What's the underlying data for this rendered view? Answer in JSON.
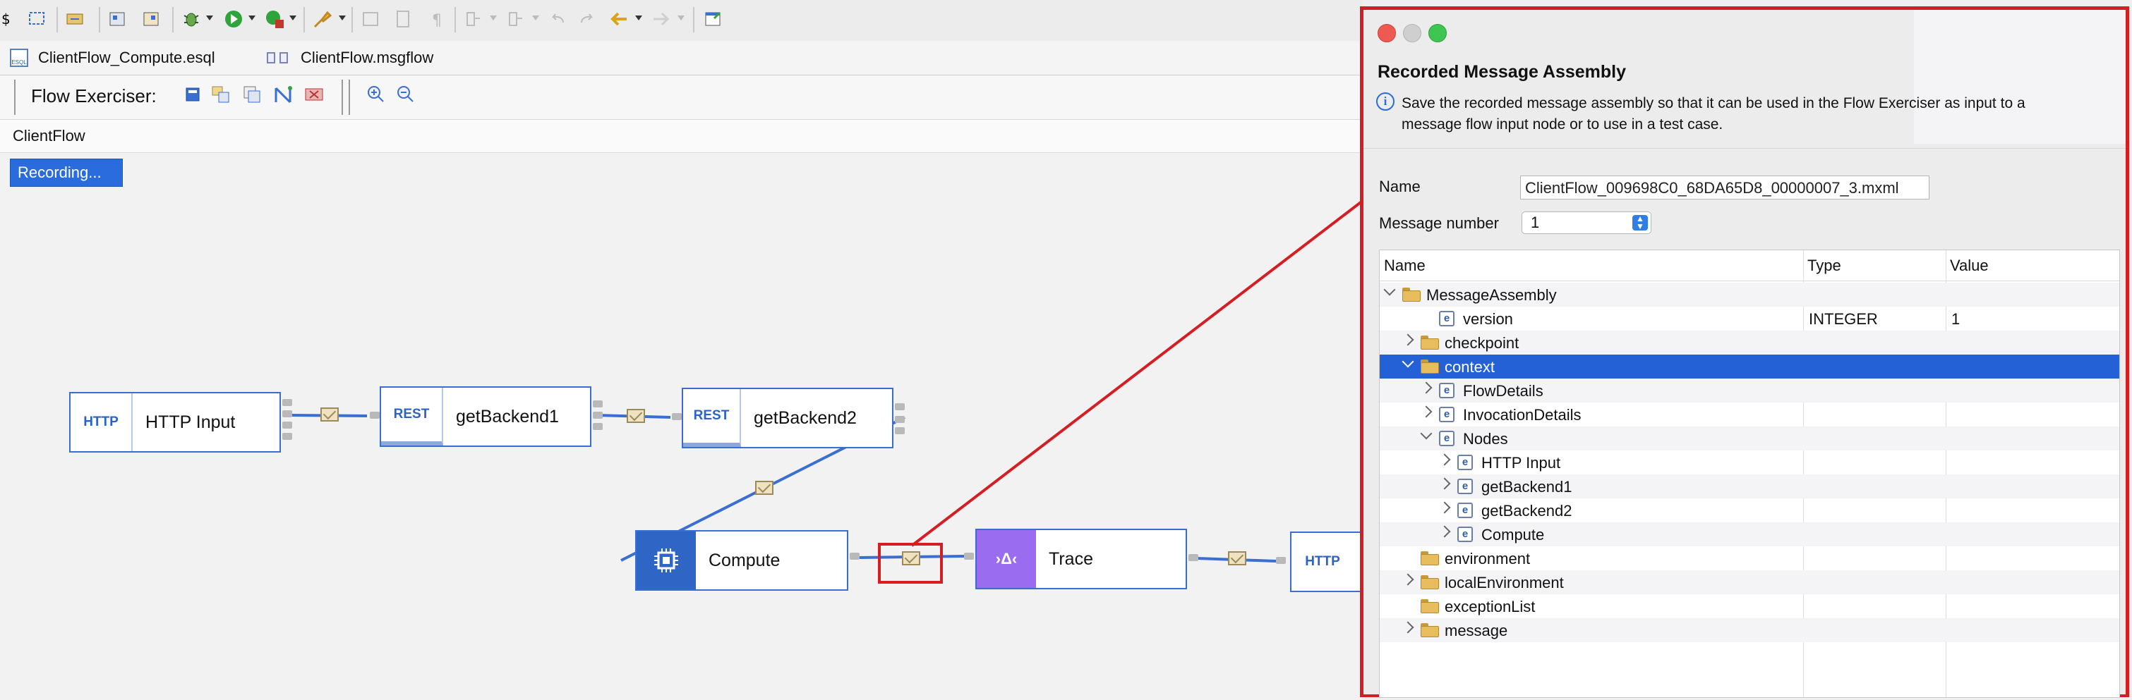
{
  "toolbar": {
    "icons": [
      "new-wizard-icon",
      "open-icon",
      "project-icon",
      "deploy-icon",
      "package-icon",
      "debug-icon",
      "run-icon",
      "run-remote-icon",
      "connect-icon",
      "disabled-icon",
      "disabled-icon",
      "pilcrow-icon",
      "disabled-icon",
      "disabled-icon",
      "undo-icon",
      "redo-icon",
      "back-icon",
      "forward-icon",
      "open-editor-icon"
    ]
  },
  "tabs": [
    {
      "label": "ClientFlow_Compute.esql",
      "icon": "esql-file-icon"
    },
    {
      "label": "ClientFlow.msgflow",
      "icon": "msgflow-file-icon"
    }
  ],
  "exerciser": {
    "label": "Flow Exerciser:"
  },
  "breadcrumb": "ClientFlow",
  "recording": "Recording...",
  "nodes": {
    "http_input": {
      "icon": "HTTP",
      "label": "HTTP Input"
    },
    "get1": {
      "icon": "REST",
      "label": "getBackend1"
    },
    "get2": {
      "icon": "REST",
      "label": "getBackend2"
    },
    "compute": {
      "label": "Compute"
    },
    "trace": {
      "icon": "›Δ‹",
      "label": "Trace"
    },
    "http_reply": {
      "icon": "HTTP"
    }
  },
  "dialog": {
    "title": "Recorded Message Assembly",
    "info": "Save the recorded message assembly so that it can be used in the Flow Exerciser as input to a message flow input node or to use in a test case.",
    "name_label": "Name",
    "name_value": "ClientFlow_009698C0_68DA65D8_00000007_3.mxml",
    "msgnum_label": "Message number",
    "msgnum_value": "1",
    "columns": [
      "Name",
      "Type",
      "Value"
    ],
    "tree": [
      {
        "label": "MessageAssembly",
        "icon": "folder",
        "level": 0,
        "chevron": "down",
        "type": "",
        "value": ""
      },
      {
        "label": "version",
        "icon": "element",
        "level": 2,
        "chevron": "",
        "type": "INTEGER",
        "value": "1"
      },
      {
        "label": "checkpoint",
        "icon": "folder",
        "level": 1,
        "chevron": "right",
        "type": "",
        "value": ""
      },
      {
        "label": "context",
        "icon": "folder",
        "level": 1,
        "chevron": "down",
        "type": "",
        "value": "",
        "selected": true
      },
      {
        "label": "FlowDetails",
        "icon": "element",
        "level": 2,
        "chevron": "right",
        "type": "",
        "value": ""
      },
      {
        "label": "InvocationDetails",
        "icon": "element",
        "level": 2,
        "chevron": "right",
        "type": "",
        "value": ""
      },
      {
        "label": "Nodes",
        "icon": "element",
        "level": 2,
        "chevron": "down",
        "type": "",
        "value": ""
      },
      {
        "label": "HTTP Input",
        "icon": "element",
        "level": 3,
        "chevron": "right",
        "type": "",
        "value": ""
      },
      {
        "label": "getBackend1",
        "icon": "element",
        "level": 3,
        "chevron": "right",
        "type": "",
        "value": ""
      },
      {
        "label": "getBackend2",
        "icon": "element",
        "level": 3,
        "chevron": "right",
        "type": "",
        "value": ""
      },
      {
        "label": "Compute",
        "icon": "element",
        "level": 3,
        "chevron": "right",
        "type": "",
        "value": ""
      },
      {
        "label": "environment",
        "icon": "folder",
        "level": 1,
        "chevron": "",
        "type": "",
        "value": ""
      },
      {
        "label": "localEnvironment",
        "icon": "folder",
        "level": 1,
        "chevron": "right",
        "type": "",
        "value": ""
      },
      {
        "label": "exceptionList",
        "icon": "folder",
        "level": 1,
        "chevron": "",
        "type": "",
        "value": ""
      },
      {
        "label": "message",
        "icon": "folder",
        "level": 1,
        "chevron": "right",
        "type": "",
        "value": ""
      }
    ]
  },
  "colors": {
    "accent": "#2a6cdb",
    "highlight": "#d41e24",
    "selection": "#2460d6",
    "trace": "#9a6cf0",
    "compute": "#2f66c6"
  }
}
